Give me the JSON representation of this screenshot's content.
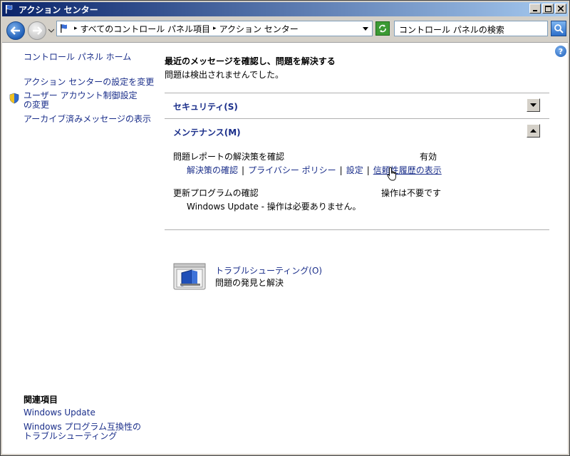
{
  "window": {
    "title": "アクション センター"
  },
  "address": {
    "breadcrumb": [
      "すべてのコントロール パネル項目",
      "アクション センター"
    ],
    "search_placeholder": "コントロール パネルの検索"
  },
  "sidebar": {
    "home": "コントロール パネル ホーム",
    "items": [
      "アクション センターの設定を変更",
      "ユーザー アカウント制御設定の変更",
      "アーカイブ済みメッセージの表示"
    ],
    "related_title": "関連項目",
    "related": [
      "Windows Update",
      "Windows プログラム互換性のトラブルシューティング"
    ]
  },
  "main": {
    "title": "最近のメッセージを確認し、問題を解決する",
    "subtitle": "問題は検出されませんでした。",
    "security": {
      "header": "セキュリティ(S)"
    },
    "maintenance": {
      "header": "メンテナンス(M)",
      "item1_label": "問題レポートの解決策を確認",
      "item1_status": "有効",
      "links": [
        "解決策の確認",
        "プライバシー ポリシー",
        "設定",
        "信頼性履歴の表示"
      ],
      "item2_label": "更新プログラムの確認",
      "item2_status": "操作は不要です",
      "item2_detail": "Windows Update - 操作は必要ありません。"
    },
    "troubleshooting": {
      "title": "トラブルシューティング(O)",
      "subtitle": "問題の発見と解決"
    }
  },
  "colors": {
    "link": "#1a2e8a",
    "titlebar_start": "#0a246a",
    "titlebar_end": "#a6caf0"
  }
}
